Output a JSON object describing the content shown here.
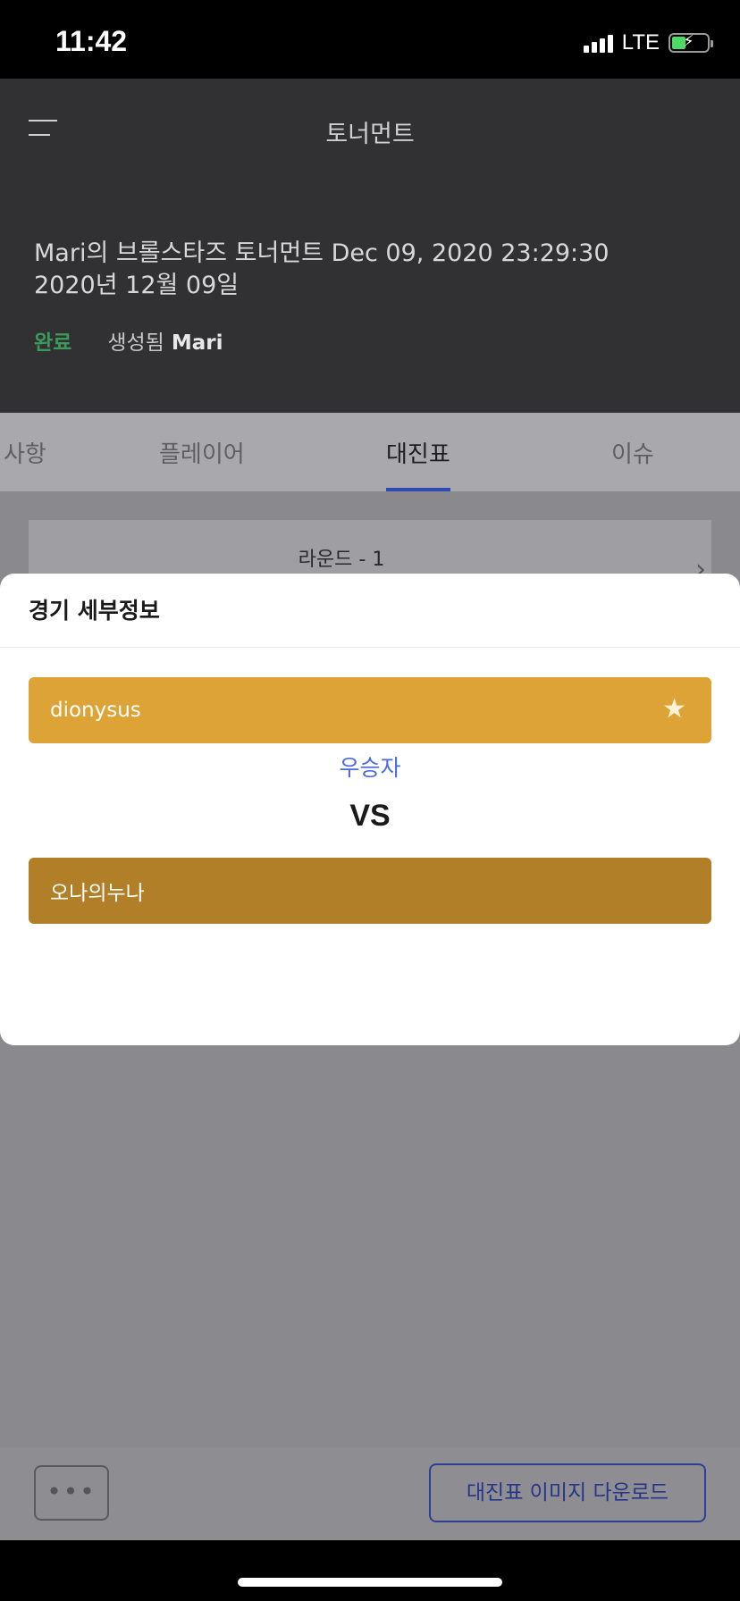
{
  "status_bar": {
    "time": "11:42",
    "network": "LTE"
  },
  "header": {
    "title": "토너먼트",
    "tournament_title": "Mari의 브롤스타즈 토너먼트 Dec 09, 2020 23:29:30",
    "tournament_date": "2020년 12월 09일",
    "status": "완료",
    "created_label": "생성됨",
    "creator": "Mari"
  },
  "tabs": [
    {
      "label": "사항"
    },
    {
      "label": "플레이어"
    },
    {
      "label": "대진표",
      "active": true
    },
    {
      "label": "이슈"
    }
  ],
  "round": {
    "label": "라운드 - 1"
  },
  "modal": {
    "title": "경기 세부정보",
    "player1": "dionysus",
    "winner_label": "우승자",
    "vs": "VS",
    "player2": "오나의누나"
  },
  "bottom": {
    "more_label": "•••",
    "download_label": "대진표 이미지 다운로드"
  },
  "colors": {
    "header_bg": "#313133",
    "status_done": "#3a9a5a",
    "player1_bg": "#dda336",
    "player2_bg": "#b07f28",
    "winner_text": "#4a6ad8",
    "accent": "#3048b8"
  }
}
